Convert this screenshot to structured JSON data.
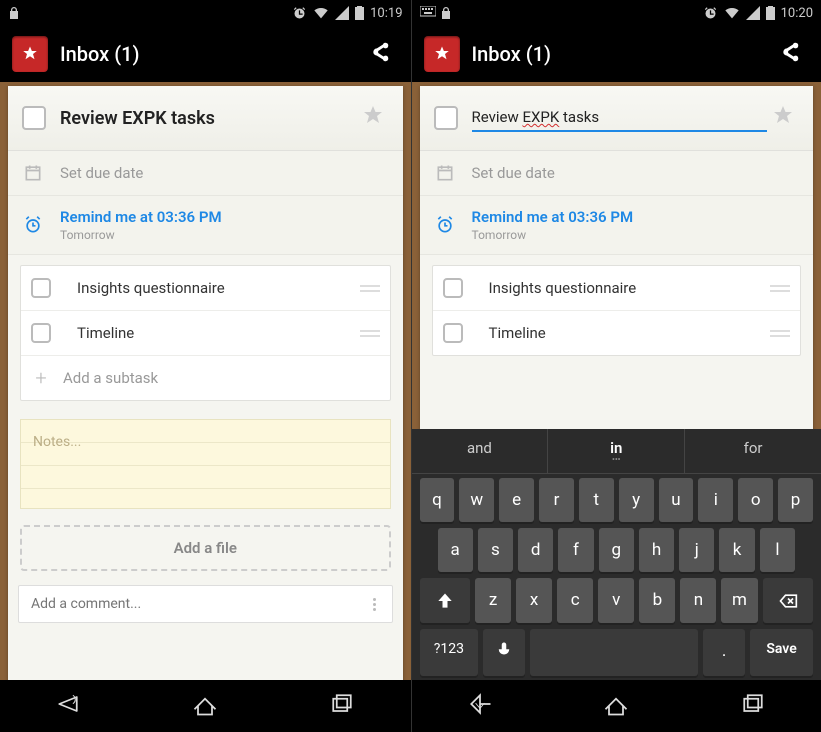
{
  "left": {
    "status": {
      "time": "10:19"
    },
    "header": {
      "title": "Inbox (1)"
    },
    "task": {
      "title": "Review EXPK tasks"
    },
    "meta": {
      "due_label": "Set due date",
      "remind_label": "Remind me at 03:36 PM",
      "remind_sub": "Tomorrow"
    },
    "subtasks": [
      {
        "label": "Insights questionnaire"
      },
      {
        "label": "Timeline"
      }
    ],
    "add_subtask_placeholder": "Add a subtask",
    "notes_placeholder": "Notes...",
    "add_file_label": "Add a file",
    "comment_placeholder": "Add a comment..."
  },
  "right": {
    "status": {
      "time": "10:20"
    },
    "header": {
      "title": "Inbox (1)"
    },
    "task": {
      "title_value": "Review EXPK tasks",
      "underlined_word": "EXPK"
    },
    "meta": {
      "due_label": "Set due date",
      "remind_label": "Remind me at 03:36 PM",
      "remind_sub": "Tomorrow"
    },
    "subtasks": [
      {
        "label": "Insights questionnaire"
      },
      {
        "label": "Timeline"
      }
    ],
    "keyboard": {
      "suggestions": [
        "and",
        "in",
        "for"
      ],
      "row1": [
        "q",
        "w",
        "e",
        "r",
        "t",
        "y",
        "u",
        "i",
        "o",
        "p"
      ],
      "row2": [
        "a",
        "s",
        "d",
        "f",
        "g",
        "h",
        "j",
        "k",
        "l"
      ],
      "row3": [
        "z",
        "x",
        "c",
        "v",
        "b",
        "n",
        "m"
      ],
      "symbols_label": "?123",
      "period": ".",
      "save_label": "Save"
    }
  }
}
